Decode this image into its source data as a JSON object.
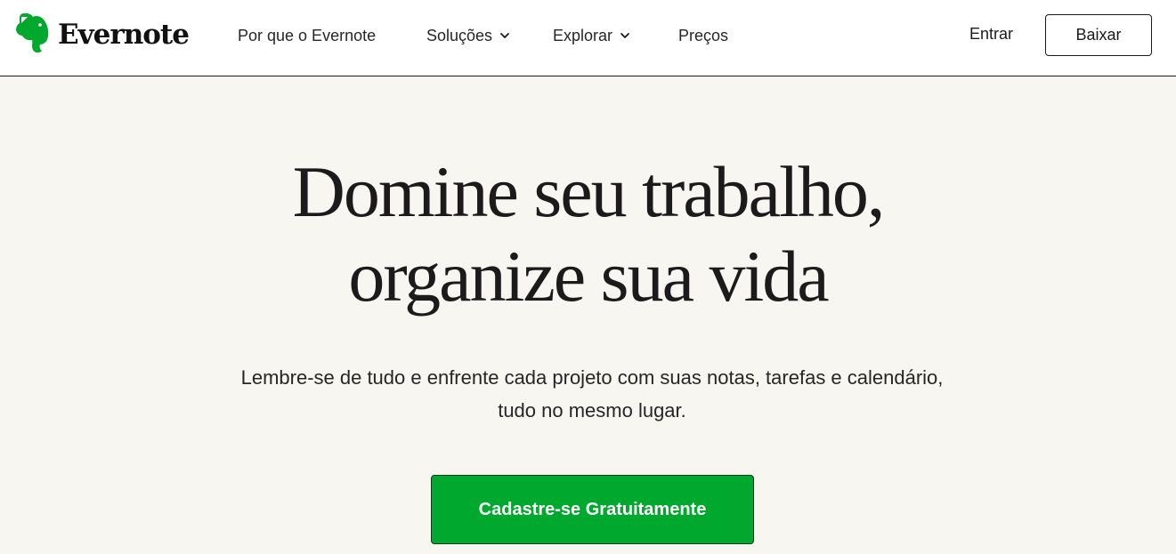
{
  "header": {
    "brand": "Evernote",
    "nav": [
      {
        "label": "Por que o Evernote",
        "has_dropdown": false
      },
      {
        "label": "Soluções",
        "has_dropdown": true
      },
      {
        "label": "Explorar",
        "has_dropdown": true
      },
      {
        "label": "Preços",
        "has_dropdown": false
      }
    ],
    "signin_label": "Entrar",
    "download_label": "Baixar"
  },
  "hero": {
    "title_line1": "Domine seu trabalho,",
    "title_line2": "organize sua vida",
    "subtitle": "Lembre-se de tudo e enfrente cada projeto com suas notas, tarefas e calendário, tudo no mesmo lugar.",
    "cta_label": "Cadastre-se Gratuitamente"
  },
  "colors": {
    "brand_green": "#00a82d",
    "page_background": "#f8f6f1",
    "text": "#1b1b1b"
  },
  "icons": {
    "logo": "evernote-elephant-icon",
    "dropdown": "chevron-down-icon"
  }
}
